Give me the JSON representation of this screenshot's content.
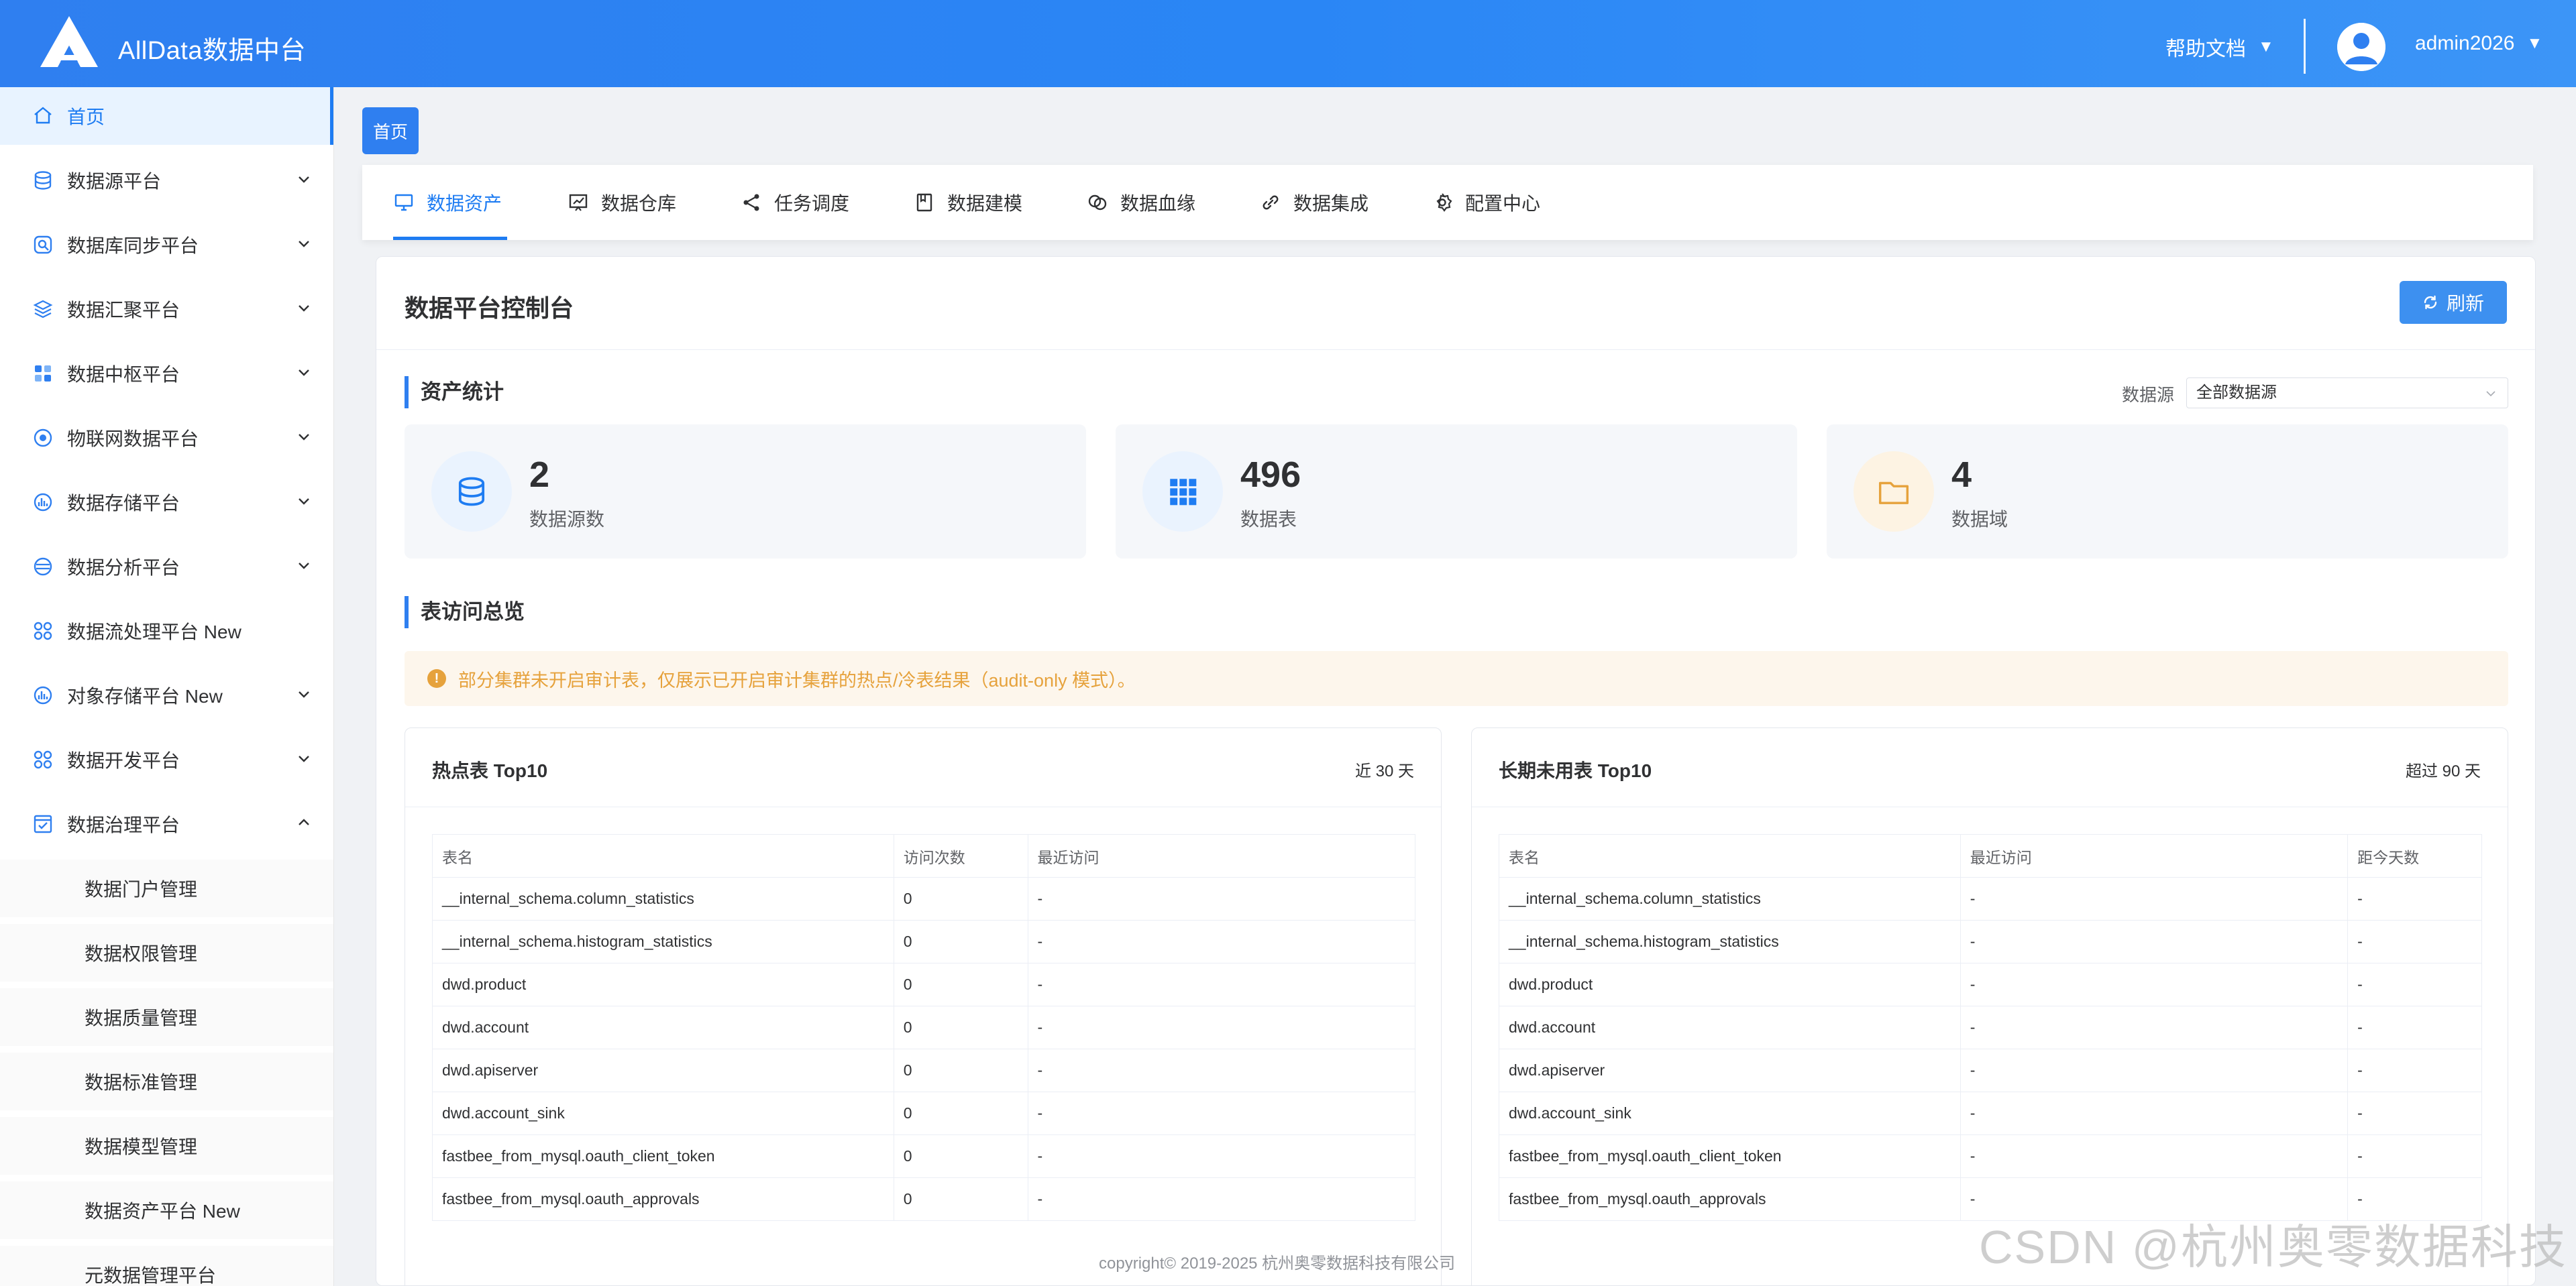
{
  "header": {
    "app_title": "AllData数据中台",
    "help_label": "帮助文档",
    "username": "admin2026",
    "caret": "▼"
  },
  "sidebar": {
    "items": [
      {
        "label": "首页",
        "icon": "home-icon",
        "active": true,
        "expandable": false
      },
      {
        "label": "数据源平台",
        "icon": "database-icon",
        "expandable": true,
        "expanded": false
      },
      {
        "label": "数据库同步平台",
        "icon": "sync-icon",
        "expandable": true,
        "expanded": false
      },
      {
        "label": "数据汇聚平台",
        "icon": "layers-icon",
        "expandable": true,
        "expanded": false
      },
      {
        "label": "数据中枢平台",
        "icon": "hub-icon",
        "expandable": true,
        "expanded": false
      },
      {
        "label": "物联网数据平台",
        "icon": "iot-icon",
        "expandable": true,
        "expanded": false
      },
      {
        "label": "数据存储平台",
        "icon": "storage-icon",
        "expandable": true,
        "expanded": false
      },
      {
        "label": "数据分析平台",
        "icon": "analysis-icon",
        "expandable": true,
        "expanded": false
      },
      {
        "label": "数据流处理平台 New",
        "icon": "stream-icon",
        "expandable": false
      },
      {
        "label": "对象存储平台 New",
        "icon": "object-storage-icon",
        "expandable": true,
        "expanded": false
      },
      {
        "label": "数据开发平台",
        "icon": "develop-icon",
        "expandable": true,
        "expanded": false
      },
      {
        "label": "数据治理平台",
        "icon": "governance-icon",
        "expandable": true,
        "expanded": true
      }
    ],
    "sub_items": [
      "数据门户管理",
      "数据权限管理",
      "数据质量管理",
      "数据标准管理",
      "数据模型管理",
      "数据资产平台 New",
      "元数据管理平台"
    ]
  },
  "breadcrumb_tag": "首页",
  "nav_tabs": [
    {
      "label": "数据资产",
      "icon": "monitor-icon",
      "active": true
    },
    {
      "label": "数据仓库",
      "icon": "chart-board-icon"
    },
    {
      "label": "任务调度",
      "icon": "share-icon"
    },
    {
      "label": "数据建模",
      "icon": "notebook-icon"
    },
    {
      "label": "数据血缘",
      "icon": "copy-link-icon"
    },
    {
      "label": "数据集成",
      "icon": "link-icon"
    },
    {
      "label": "配置中心",
      "icon": "gear-icon"
    }
  ],
  "panel": {
    "title": "数据平台控制台",
    "refresh_label": "刷新",
    "asset_section_title": "资产统计",
    "filter_label": "数据源",
    "filter_value": "全部数据源",
    "stats": [
      {
        "value": "2",
        "label": "数据源数",
        "icon": "database-icon",
        "color": "#1e7cf2",
        "bg": "#eaf3fe"
      },
      {
        "value": "496",
        "label": "数据表",
        "icon": "grid-icon",
        "color": "#1e7cf2",
        "bg": "#eaf3fe"
      },
      {
        "value": "4",
        "label": "数据域",
        "icon": "folder-icon",
        "color": "#e6a23c",
        "bg": "#fdf3e3"
      }
    ],
    "access_section_title": "表访问总览",
    "alert_text": "部分集群未开启审计表，仅展示已开启审计集群的热点/冷表结果（audit-only 模式）。"
  },
  "hot_table": {
    "title": "热点表 Top10",
    "range": "近 30 天",
    "headers": [
      "表名",
      "访问次数",
      "最近访问"
    ],
    "rows": [
      [
        "__internal_schema.column_statistics",
        "0",
        "-"
      ],
      [
        "__internal_schema.histogram_statistics",
        "0",
        "-"
      ],
      [
        "dwd.product",
        "0",
        "-"
      ],
      [
        "dwd.account",
        "0",
        "-"
      ],
      [
        "dwd.apiserver",
        "0",
        "-"
      ],
      [
        "dwd.account_sink",
        "0",
        "-"
      ],
      [
        "fastbee_from_mysql.oauth_client_token",
        "0",
        "-"
      ],
      [
        "fastbee_from_mysql.oauth_approvals",
        "0",
        "-"
      ]
    ]
  },
  "cold_table": {
    "title": "长期未用表 Top10",
    "range": "超过 90 天",
    "headers": [
      "表名",
      "最近访问",
      "距今天数"
    ],
    "rows": [
      [
        "__internal_schema.column_statistics",
        "-",
        "-"
      ],
      [
        "__internal_schema.histogram_statistics",
        "-",
        "-"
      ],
      [
        "dwd.product",
        "-",
        "-"
      ],
      [
        "dwd.account",
        "-",
        "-"
      ],
      [
        "dwd.apiserver",
        "-",
        "-"
      ],
      [
        "dwd.account_sink",
        "-",
        "-"
      ],
      [
        "fastbee_from_mysql.oauth_client_token",
        "-",
        "-"
      ],
      [
        "fastbee_from_mysql.oauth_approvals",
        "-",
        "-"
      ]
    ]
  },
  "footer": "copyright© 2019-2025 杭州奥零数据科技有限公司",
  "watermark": "CSDN @杭州奥零数据科技"
}
